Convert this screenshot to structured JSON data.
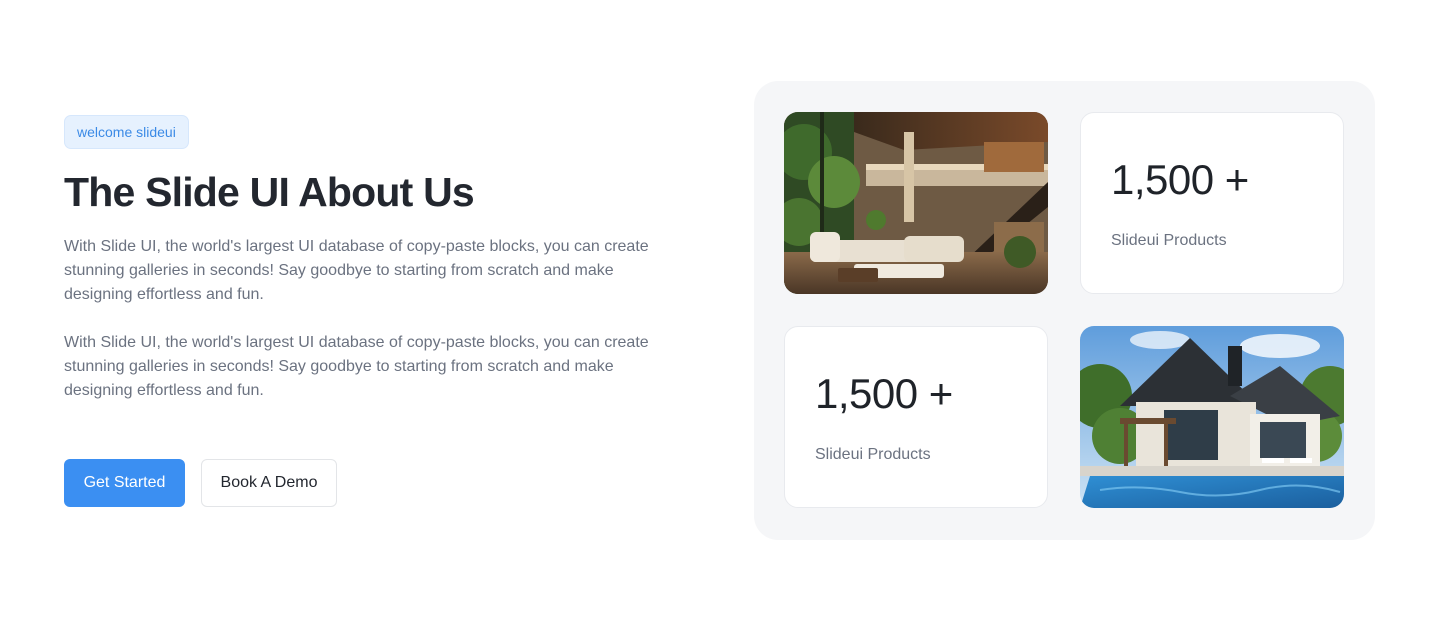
{
  "hero": {
    "badge": "welcome slideui",
    "title": "The Slide UI About Us",
    "paragraphs": [
      "With Slide UI, the world's largest UI database of copy-paste blocks, you can create stunning galleries in seconds! Say goodbye to starting from scratch and make designing effortless and fun.",
      "With Slide UI, the world's largest UI database of copy-paste blocks, you can create stunning galleries in seconds! Say goodbye to starting from scratch and make designing effortless and fun."
    ],
    "primary_button": "Get Started",
    "secondary_button": "Book A Demo"
  },
  "gallery": {
    "stats": [
      {
        "value": "1,500 +",
        "label": "Slideui Products"
      },
      {
        "value": "1,500 +",
        "label": "Slideui Products"
      }
    ],
    "images": [
      {
        "icon": "interior-living-room-photo"
      },
      {
        "icon": "modern-house-pool-photo"
      }
    ]
  },
  "colors": {
    "accent": "#3b8ff2",
    "badge_bg": "#e6f1fe",
    "badge_text": "#3b8ae6",
    "heading": "#23272f",
    "body_text": "#6b7280",
    "panel_bg": "#f5f6f8"
  }
}
